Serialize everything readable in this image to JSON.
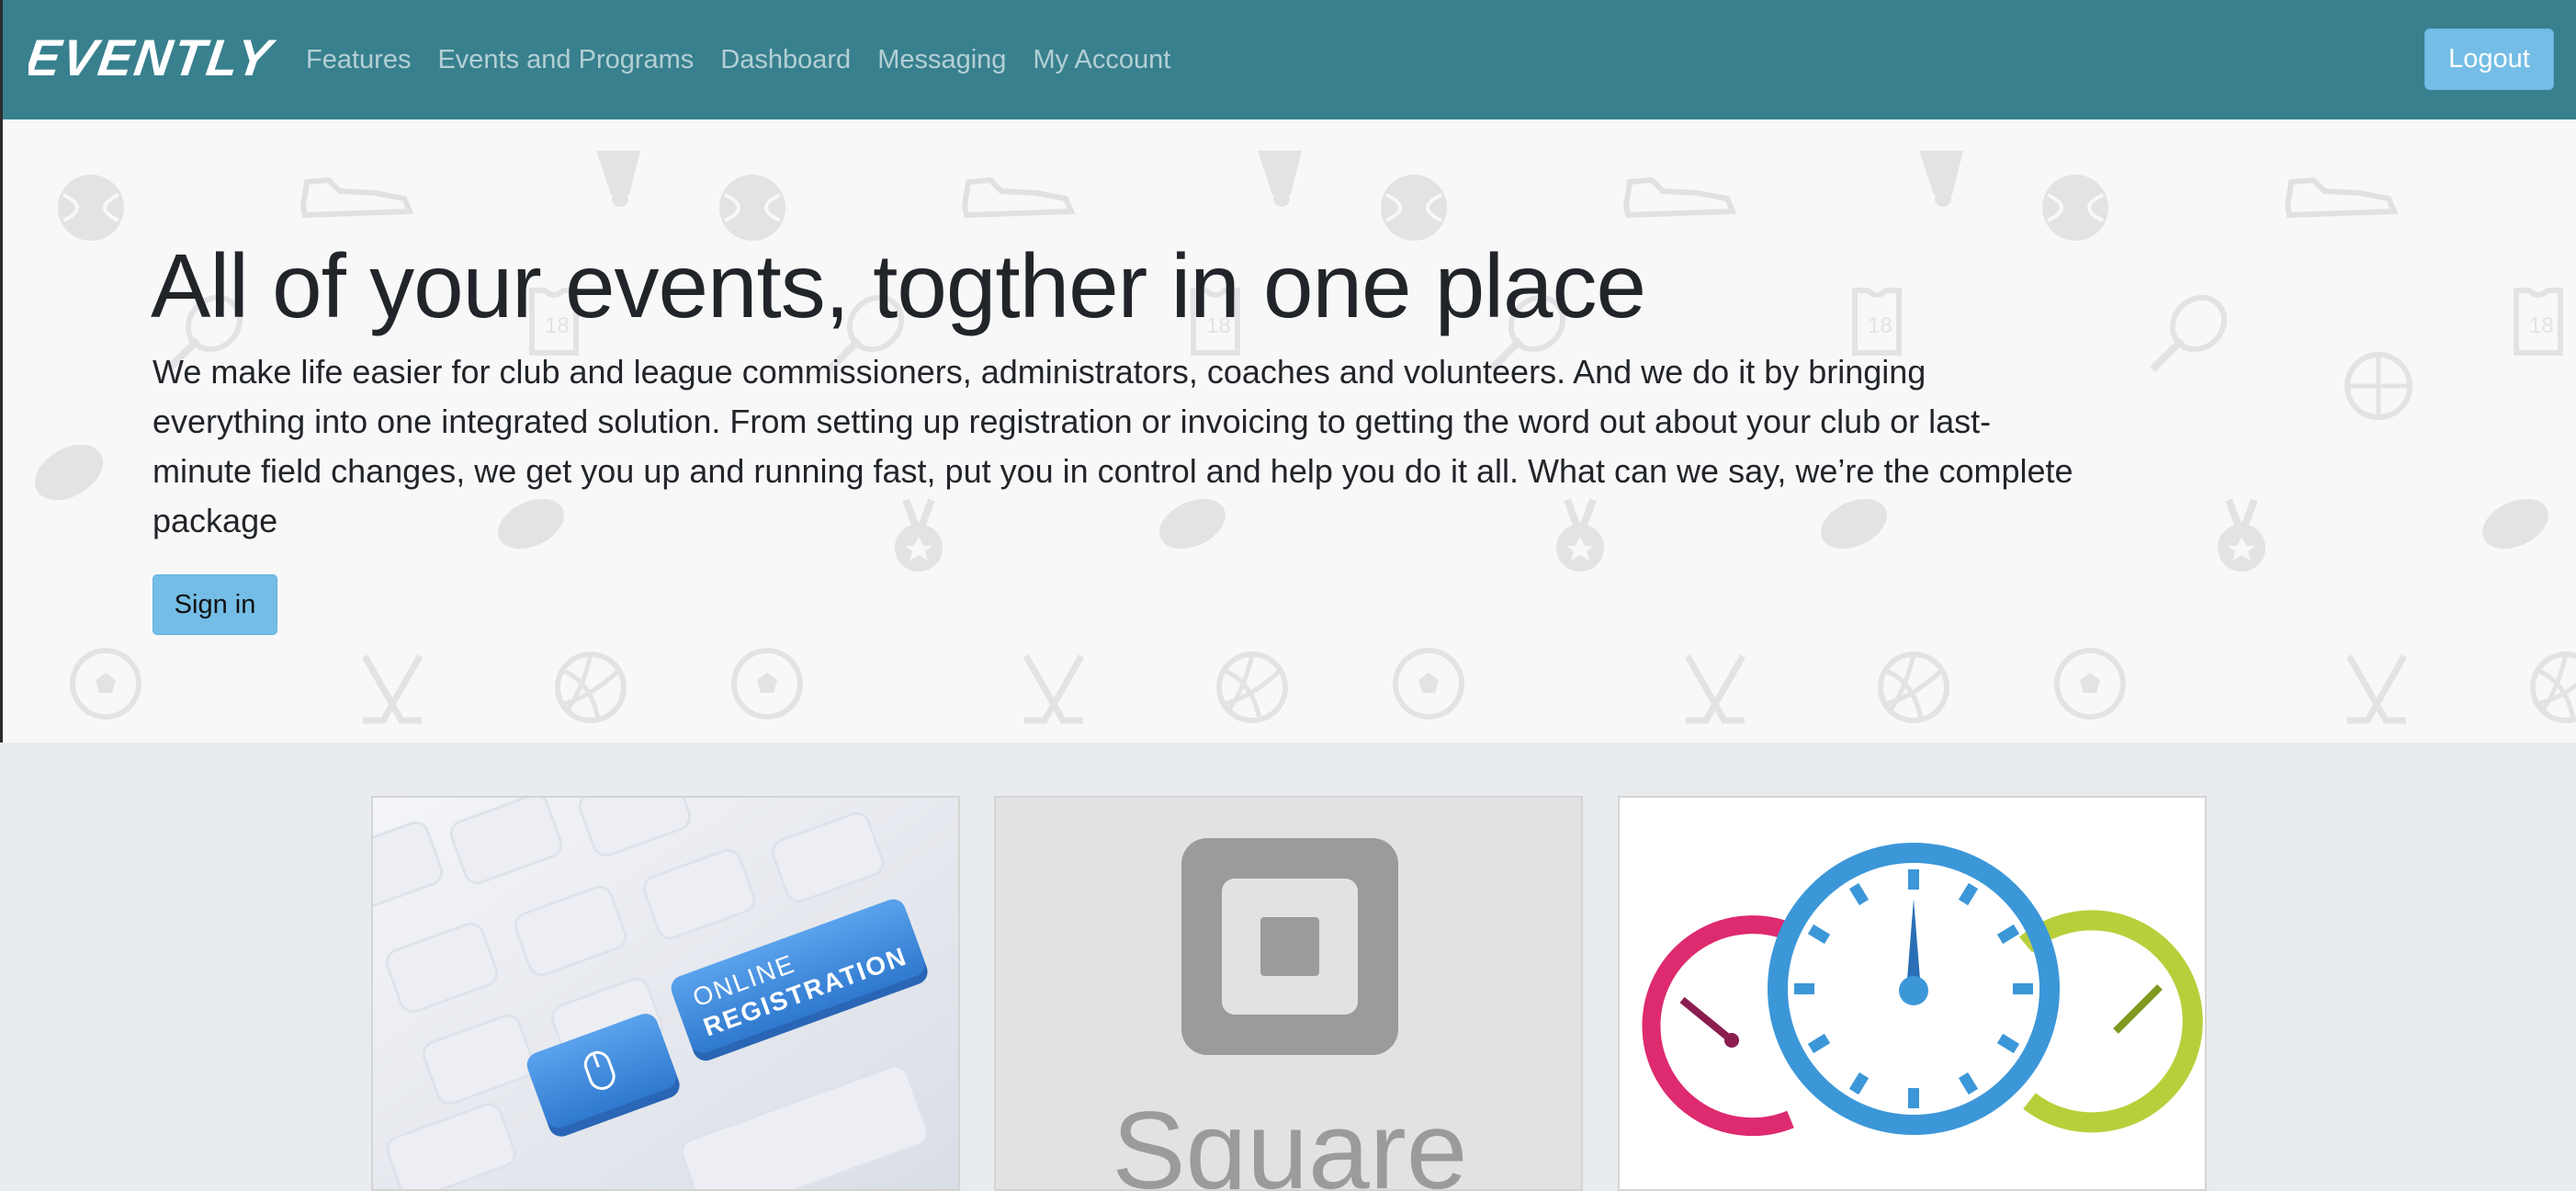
{
  "nav": {
    "brand": "EVENTLY",
    "links": [
      "Features",
      "Events and Programs",
      "Dashboard",
      "Messaging",
      "My Account"
    ],
    "logout_label": "Logout"
  },
  "hero": {
    "title": "All of your events, togther in one place",
    "description": "We make life easier for club and league commissioners, administrators, coaches and volunteers. And we do it by bringing everything into one integrated solution. From setting up registration or invoicing to getting the word out about your club or last-minute field changes, we get you up and running fast, put you in control and help you do it all. What can we say, we’re the complete package",
    "signin_label": "Sign in"
  },
  "cards": [
    {
      "image": "online-registration-keyboard",
      "key_text_1": "ONLINE",
      "key_text_2": "REGISTRATION"
    },
    {
      "image": "square-logo",
      "logo_text": "Square"
    },
    {
      "image": "speedometer-gauges"
    }
  ],
  "colors": {
    "navbar": "#38808e",
    "button": "#74bde6",
    "hero_bg": "#f8f8f9",
    "page_bg": "#e9ecef"
  }
}
